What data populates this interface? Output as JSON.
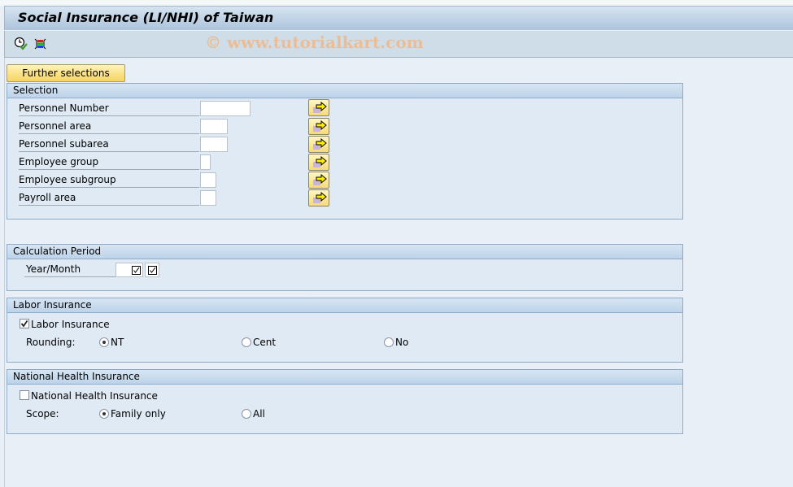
{
  "window": {
    "title": "Social Insurance (LI/NHI) of Taiwan",
    "watermark": "© www.tutorialkart.com"
  },
  "toolbar": {
    "icons": [
      {
        "name": "execute-background-icon",
        "tooltip": ""
      },
      {
        "name": "variant-icon",
        "tooltip": ""
      }
    ]
  },
  "buttons": {
    "further_selections": "Further selections"
  },
  "selection": {
    "title": "Selection",
    "fields": [
      {
        "label": "Personnel Number",
        "value": ""
      },
      {
        "label": "Personnel area",
        "value": ""
      },
      {
        "label": "Personnel subarea",
        "value": ""
      },
      {
        "label": "Employee group",
        "value": ""
      },
      {
        "label": "Employee subgroup",
        "value": ""
      },
      {
        "label": "Payroll area",
        "value": ""
      }
    ]
  },
  "calculation_period": {
    "title": "Calculation Period",
    "year_month_label": "Year/Month",
    "year_month_value": ""
  },
  "labor_insurance": {
    "title": "Labor Insurance",
    "checkbox_label": "Labor Insurance",
    "checked": true,
    "rounding_label": "Rounding:",
    "options": [
      "NT",
      "Cent",
      "No"
    ],
    "selected": "NT"
  },
  "national_health_insurance": {
    "title": "National Health Insurance",
    "checkbox_label": "National Health Insurance",
    "checked": false,
    "scope_label": "Scope:",
    "options": [
      "Family only",
      "All"
    ],
    "selected": "Family only"
  }
}
